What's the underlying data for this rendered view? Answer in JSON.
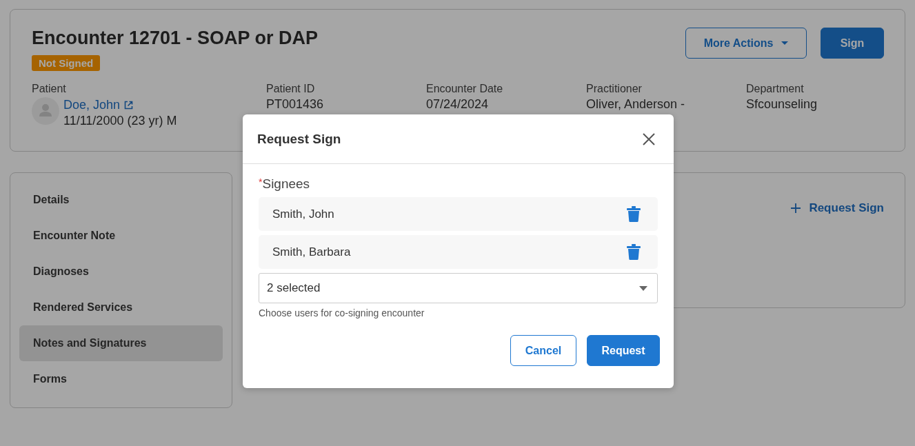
{
  "header": {
    "title": "Encounter 12701 - SOAP or DAP",
    "status_badge": "Not Signed",
    "buttons": [
      {
        "label": "More Actions",
        "kind": "dropdown"
      },
      {
        "label": "Sign",
        "kind": "primary"
      }
    ]
  },
  "patient": {
    "label": "Patient",
    "name": "Doe, John",
    "details": "11/11/2000 (23 yr) M"
  },
  "fields": [
    {
      "label": "Patient ID",
      "value": "PT001436"
    },
    {
      "label": "Encounter Date",
      "value": "07/24/2024"
    },
    {
      "label": "Practitioner",
      "value": "Oliver, Anderson -"
    },
    {
      "label": "Department",
      "value": "Sfcounseling"
    }
  ],
  "sidebar": {
    "items": [
      {
        "label": "Details",
        "selected": false
      },
      {
        "label": "Encounter Note",
        "selected": false
      },
      {
        "label": "Diagnoses",
        "selected": false
      },
      {
        "label": "Rendered Services",
        "selected": false
      },
      {
        "label": "Notes and Signatures",
        "selected": true
      },
      {
        "label": "Forms",
        "selected": false
      }
    ]
  },
  "notes_panel": {
    "link": "Request Sign"
  },
  "dialog": {
    "title": "Request Sign",
    "required_mark": "*",
    "field_label": "Signees",
    "signees": [
      {
        "name": "Smith, John"
      },
      {
        "name": "Smith, Barbara"
      }
    ],
    "select": {
      "value": "2 selected"
    },
    "help": "Choose users for co-signing encounter",
    "buttons": [
      {
        "label": "Cancel",
        "kind": "secondary"
      },
      {
        "label": "Request",
        "kind": "primary"
      }
    ]
  }
}
